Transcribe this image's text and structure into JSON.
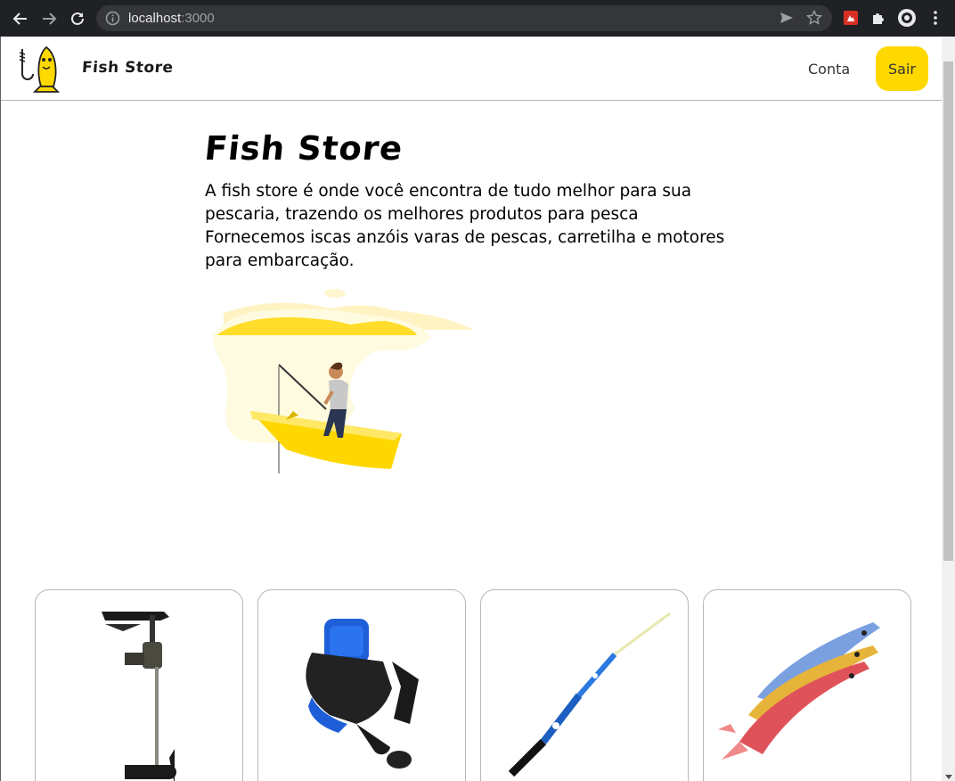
{
  "browser": {
    "url_host": "localhost",
    "url_port": ":3000",
    "back_icon": "arrow-left-icon",
    "forward_icon": "arrow-right-icon",
    "reload_icon": "reload-icon"
  },
  "header": {
    "brand_name": "Fish Store",
    "nav_conta": "Conta",
    "logout_label": "Sair",
    "accent_color": "#ffd800"
  },
  "hero": {
    "title": "Fish Store",
    "description_line1": "A fish store é onde você encontra de tudo melhor para sua pescaria, trazendo os melhores produtos para pesca",
    "description_line2": "Fornecemos iscas anzóis varas de pescas, carretilha e motores para embarcação."
  },
  "products": [
    {
      "icon": "trolling-motor-image"
    },
    {
      "icon": "fishing-reel-image"
    },
    {
      "icon": "fishing-rod-image"
    },
    {
      "icon": "shrimp-lure-image"
    }
  ]
}
